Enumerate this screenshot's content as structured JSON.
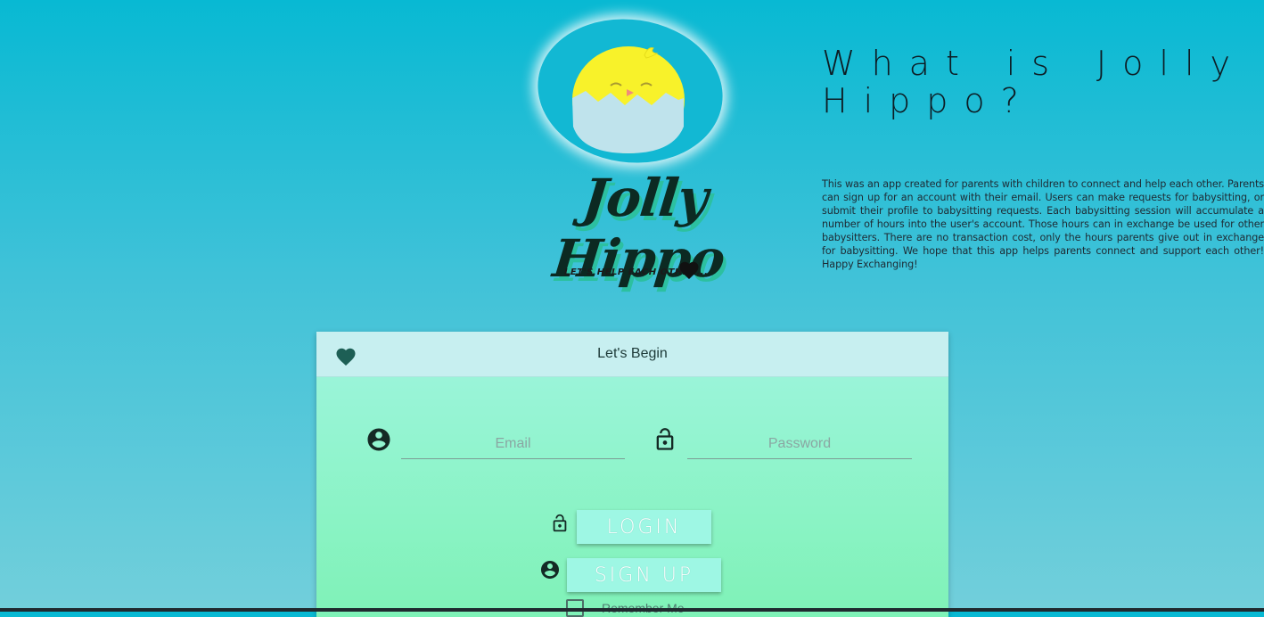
{
  "logo": {
    "brand_name": "Jolly Hippo",
    "tagline": "LET'S HELP EACH OTHER...",
    "heart_icon": "heart-icon",
    "chick_icon": "chick-in-egg-icon"
  },
  "about": {
    "title": "What is Jolly Hippo?",
    "text": "This was an app created for parents with children to connect and help each other. Parents can sign up for an account with their email. Users can make requests for babysitting, or submit their profile to babysitting requests. Each babysitting session will accumulate a number of hours into the user's account. Those hours can in exchange be used for other babysitters. There are no transaction cost, only the hours parents give out in exchange for babysitting. We hope that this app helps parents connect and support each other! Happy Exchanging!"
  },
  "card": {
    "title": "Let's Begin",
    "heart_icon": "heart-icon",
    "email": {
      "placeholder": "Email",
      "value": "",
      "icon": "account-circle-icon"
    },
    "password": {
      "placeholder": "Password",
      "value": "",
      "icon": "lock-open-icon"
    },
    "login_label": "LOGIN",
    "signup_label": "SIGN UP",
    "remember_label": "Remember Me",
    "remember_checked": false
  },
  "colors": {
    "background_top": "#08b9d3",
    "card_header": "#c7eff0",
    "card_body": "#8ff4c8",
    "button": "#9ef7e4",
    "icon": "#1a3a33"
  }
}
